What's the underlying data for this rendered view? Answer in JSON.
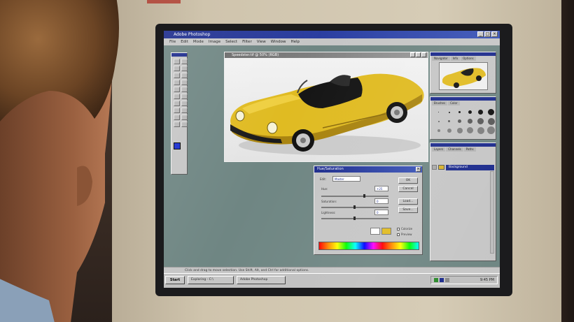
{
  "app": {
    "title": "Adobe Photoshop",
    "menu": [
      "File",
      "Edit",
      "Mode",
      "Image",
      "Select",
      "Filter",
      "View",
      "Window",
      "Help"
    ]
  },
  "image_window": {
    "title": "Speedster.tif @ 50% (RGB)"
  },
  "palettes": {
    "navigator_tabs": [
      "Navigator",
      "Info",
      "Options"
    ],
    "brushes_tabs": [
      "Brushes",
      "Color"
    ],
    "layers_tabs": [
      "Layers",
      "Channels",
      "Paths"
    ],
    "layer_name": "Background"
  },
  "dialog": {
    "title": "Hue/Saturation",
    "edit_label": "Edit:",
    "edit_value": "Master",
    "hue_label": "Hue:",
    "hue_value": "+25",
    "saturation_label": "Saturation:",
    "saturation_value": "0",
    "lightness_label": "Lightness:",
    "lightness_value": "0",
    "ok": "OK",
    "cancel": "Cancel",
    "load": "Load...",
    "save": "Save...",
    "colorize": "Colorize",
    "preview": "Preview"
  },
  "status": "Click and drag to move selection. Use Shift, Alt, and Ctrl for additional options.",
  "taskbar": {
    "start": "Start",
    "tasks": [
      "Exploring - C:\\",
      "Adobe Photoshop"
    ],
    "clock": "9:45 PM"
  },
  "colors": {
    "titlebar": "#1c2b8c",
    "car_yellow": "#e0bb22",
    "workspace": "#6f8683"
  }
}
